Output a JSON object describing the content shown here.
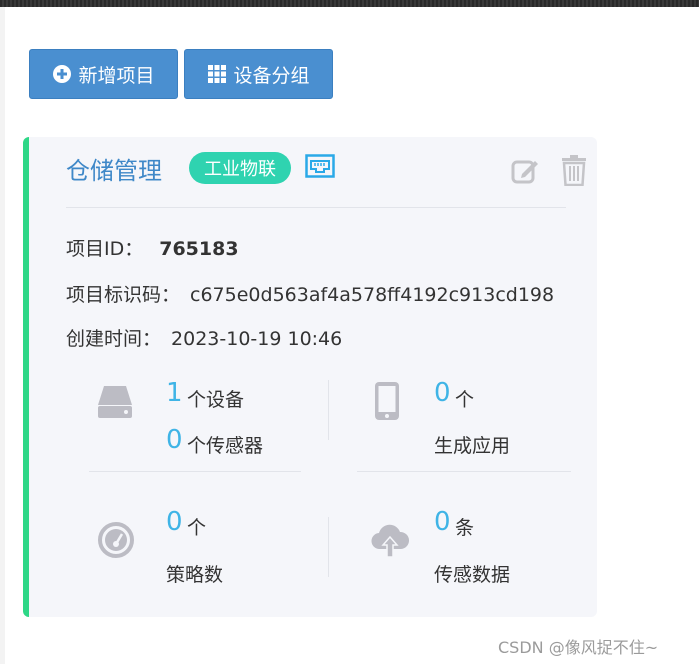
{
  "toolbar": {
    "add_label": "新增项目",
    "group_label": "设备分组",
    "button_color": "#4a8fd0"
  },
  "project": {
    "title": "仓储管理",
    "tag": "工业物联",
    "tag_color": "#2fd3b0",
    "accent_color": "#2ed787",
    "id_label": "项目ID：",
    "id_value": "765183",
    "key_label": "项目标识码：",
    "key_value": "c675e0d563af4a578ff4192c913cd198",
    "created_label": "创建时间：",
    "created_value": "2023-10-19 10:46",
    "icons": [
      "network-icon",
      "edit-icon",
      "trash-icon"
    ]
  },
  "stats": {
    "devices": {
      "count": "1",
      "unit": "个设备",
      "icon": "hard-drive-icon"
    },
    "sensors": {
      "count": "0",
      "unit": "个传感器"
    },
    "apps": {
      "count": "0",
      "unit": "个",
      "label": "生成应用",
      "icon": "mobile-phone-icon"
    },
    "strategies": {
      "count": "0",
      "unit": "个",
      "label": "策略数",
      "icon": "dashboard-icon"
    },
    "data": {
      "count": "0",
      "unit": "条",
      "label": "传感数据",
      "icon": "cloud-upload-icon"
    },
    "number_color": "#3fb4e6"
  },
  "watermark": "CSDN @像风捉不住~"
}
